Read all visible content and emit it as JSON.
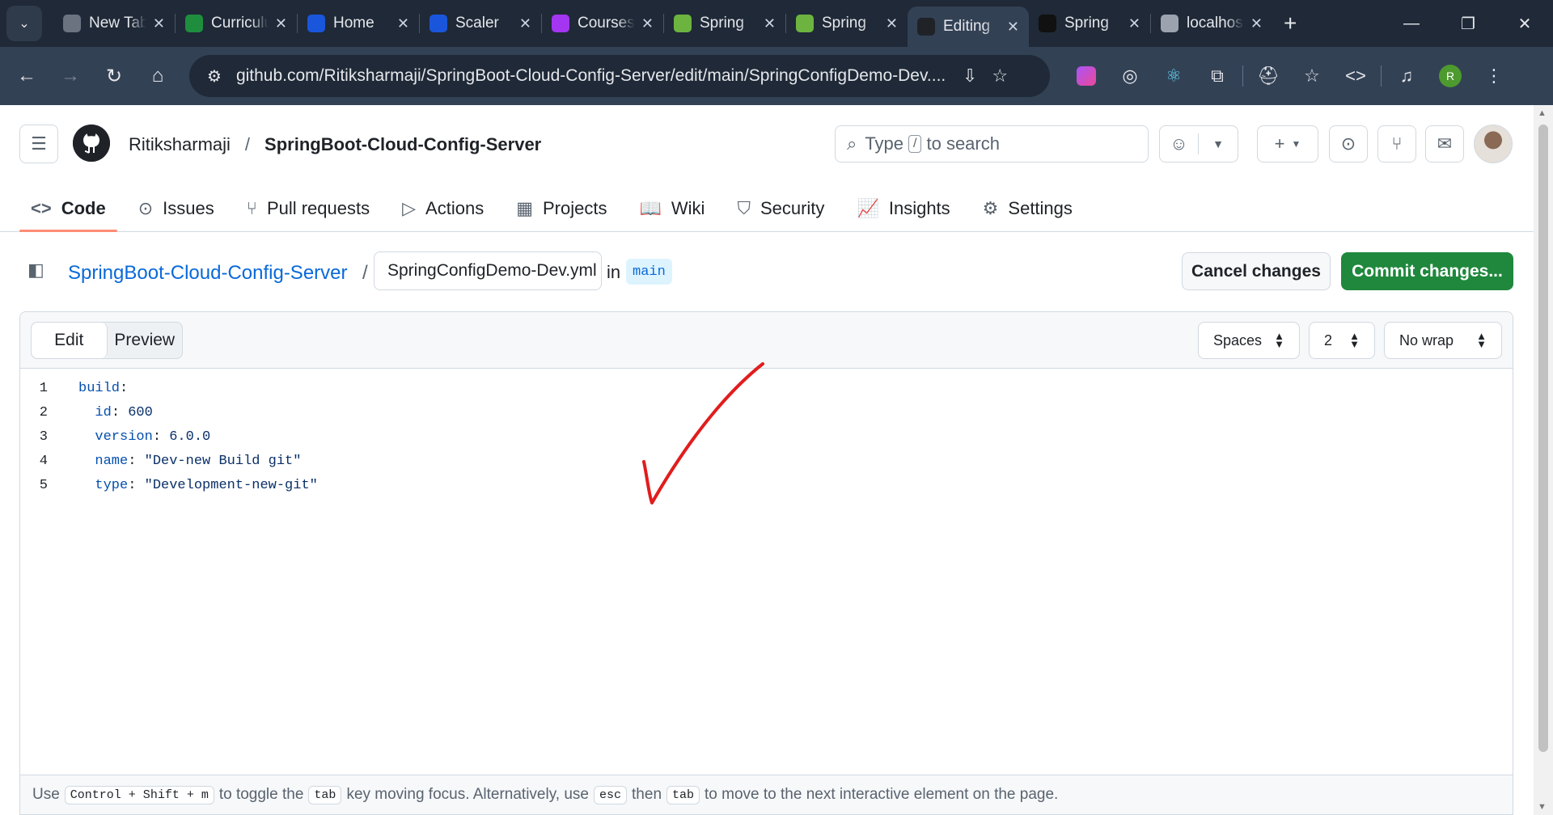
{
  "browser": {
    "tabs": [
      {
        "title": "New Tab",
        "icon": "chrome-icon",
        "color": "#6b7280"
      },
      {
        "title": "Curriculum",
        "icon": "sheets-plus-icon",
        "color": "#1e8e3e"
      },
      {
        "title": "Home",
        "icon": "scaler-icon",
        "color": "#1a56db"
      },
      {
        "title": "Scaler",
        "icon": "scaler-icon",
        "color": "#1a56db"
      },
      {
        "title": "Courses",
        "icon": "udemy-icon",
        "color": "#a435f0"
      },
      {
        "title": "Spring",
        "icon": "spring-leaf-icon",
        "color": "#6db33f"
      },
      {
        "title": "Spring",
        "icon": "spring-leaf-icon",
        "color": "#6db33f"
      },
      {
        "title": "Editing",
        "icon": "github-icon",
        "color": "#1f2328",
        "active": true
      },
      {
        "title": "Spring",
        "icon": "openai-icon",
        "color": "#111111"
      },
      {
        "title": "localhost",
        "icon": "globe-icon",
        "color": "#9ca3af"
      }
    ],
    "url": "github.com/Ritiksharmaji/SpringBoot-Cloud-Config-Server/edit/main/SpringConfigDemo-Dev....",
    "profile_initial": "R"
  },
  "header": {
    "owner": "Ritiksharmaji",
    "separator": "/",
    "repo": "SpringBoot-Cloud-Config-Server",
    "search_prefix": "Type",
    "search_key": "/",
    "search_suffix": "to search"
  },
  "repo_nav": [
    {
      "label": "Code",
      "icon": "code-icon",
      "active": true
    },
    {
      "label": "Issues",
      "icon": "issue-icon"
    },
    {
      "label": "Pull requests",
      "icon": "pull-request-icon"
    },
    {
      "label": "Actions",
      "icon": "play-icon"
    },
    {
      "label": "Projects",
      "icon": "table-icon"
    },
    {
      "label": "Wiki",
      "icon": "book-icon"
    },
    {
      "label": "Security",
      "icon": "shield-icon"
    },
    {
      "label": "Insights",
      "icon": "graph-icon"
    },
    {
      "label": "Settings",
      "icon": "gear-icon"
    }
  ],
  "editor_path": {
    "repo_link": "SpringBoot-Cloud-Config-Server",
    "slash": "/",
    "filename_value": "SpringConfigDemo-Dev.yml",
    "in_label": "in",
    "branch": "main",
    "cancel_label": "Cancel changes",
    "commit_label": "Commit changes..."
  },
  "editor": {
    "tabs": {
      "edit": "Edit",
      "preview": "Preview"
    },
    "indent_mode": "Spaces",
    "indent_size": "2",
    "wrap_mode": "No wrap",
    "lines": [
      {
        "num": "1",
        "indent": "",
        "key": "build",
        "colon": ":",
        "value": ""
      },
      {
        "num": "2",
        "indent": "  ",
        "key": "id",
        "colon": ": ",
        "value": "600"
      },
      {
        "num": "3",
        "indent": "  ",
        "key": "version",
        "colon": ": ",
        "value": "6.0.0"
      },
      {
        "num": "4",
        "indent": "  ",
        "key": "name",
        "colon": ": ",
        "value": "\"Dev-new Build git\""
      },
      {
        "num": "5",
        "indent": "  ",
        "key": "type",
        "colon": ": ",
        "value": "\"Development-new-git\""
      }
    ]
  },
  "footer": {
    "t1": "Use",
    "k1": "Control + Shift + m",
    "t2": "to toggle the",
    "k2": "tab",
    "t3": "key moving focus. Alternatively, use",
    "k3": "esc",
    "t4": "then",
    "k4": "tab",
    "t5": "to move to the next interactive element on the page."
  },
  "colors": {
    "accent_green": "#1f883d",
    "link_blue": "#0969da",
    "annotation_red": "#e11d1d"
  }
}
